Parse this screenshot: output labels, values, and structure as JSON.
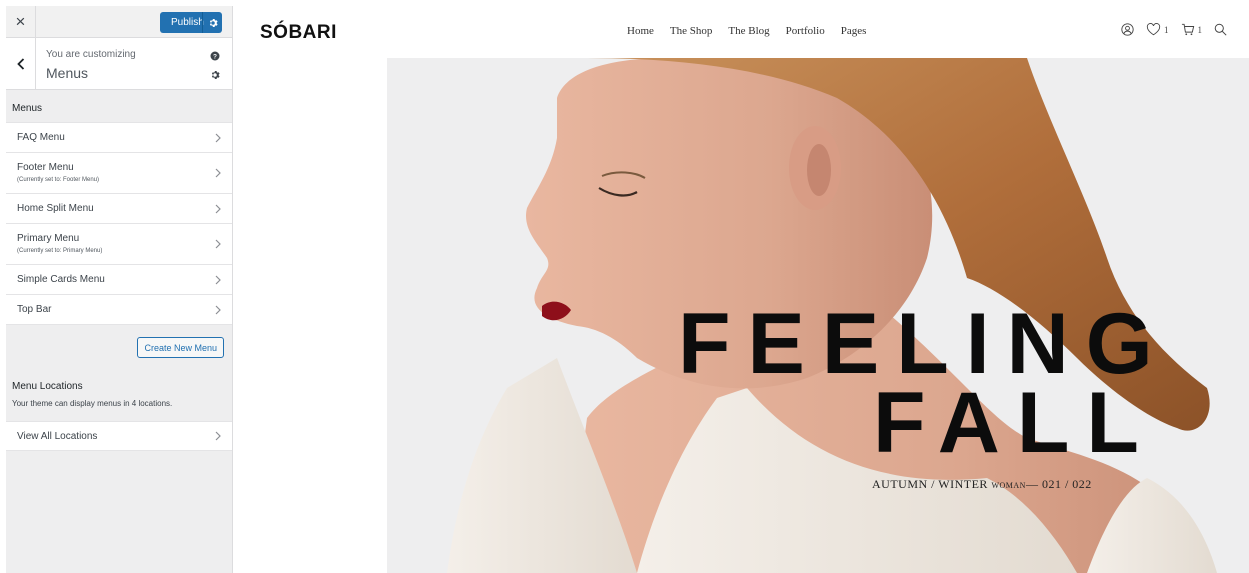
{
  "customizer": {
    "close_label": "×",
    "publish_label": "Publish",
    "customizing_label": "You are customizing",
    "customizing_title": "Menus",
    "menus_heading": "Menus",
    "menus": [
      {
        "label": "FAQ Menu",
        "sub": ""
      },
      {
        "label": "Footer Menu",
        "sub": "(Currently set to: Footer Menu)"
      },
      {
        "label": "Home Split Menu",
        "sub": ""
      },
      {
        "label": "Primary Menu",
        "sub": "(Currently set to: Primary Menu)"
      },
      {
        "label": "Simple Cards Menu",
        "sub": ""
      },
      {
        "label": "Top Bar",
        "sub": ""
      }
    ],
    "create_label": "Create New Menu",
    "locations_title": "Menu Locations",
    "locations_desc": "Your theme can display menus in 4 locations.",
    "view_locations_label": "View All Locations",
    "accent_color": "#2271b1"
  },
  "site": {
    "logo": "SÓBARI",
    "nav": [
      "Home",
      "The Shop",
      "The Blog",
      "Portfolio",
      "Pages"
    ],
    "wishlist_count": "1",
    "cart_count": "1",
    "icons": [
      "user-icon",
      "heart-icon",
      "cart-icon",
      "search-icon"
    ]
  },
  "hero": {
    "line1": "FEELING",
    "line2": "FALL",
    "sub_main": "AUTUMN / WINTER ",
    "sub_small": "WOMAN",
    "sub_end": "— 021 / 022"
  }
}
